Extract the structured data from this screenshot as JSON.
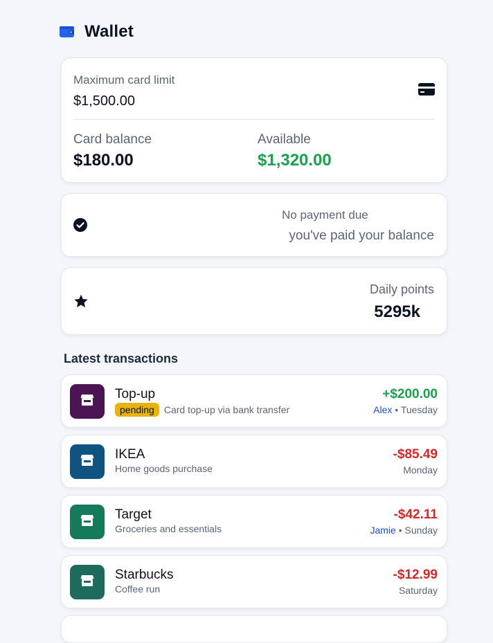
{
  "header": {
    "title": "Wallet",
    "icon": "wallet-icon",
    "accent": "#2563eb"
  },
  "limit_card": {
    "limit_label": "Maximum card limit",
    "limit_value": "$1,500.00",
    "balance_label": "Card balance",
    "balance_value": "$180.00",
    "available_label": "Available",
    "available_value": "$1,320.00",
    "icon": "credit-card-icon"
  },
  "payment_card": {
    "title": "No payment due",
    "subtitle": "you've paid your balance",
    "icon": "check-circle-icon"
  },
  "points_card": {
    "label": "Daily points",
    "value": "5295k",
    "icon": "star-icon"
  },
  "transactions": {
    "title": "Latest transactions",
    "items": [
      {
        "name": "Top-up",
        "badge": "pending",
        "description": "Card top-up via bank transfer",
        "amount": "+$200.00",
        "person": "Alex",
        "separator": " • ",
        "day": "Tuesday",
        "color": "#4a1552",
        "direction": "in",
        "icon": "store-icon"
      },
      {
        "name": "IKEA",
        "badge": "",
        "description": "Home goods purchase",
        "amount": "-$85.49",
        "person": "",
        "separator": "",
        "day": "Monday",
        "color": "#0f5480",
        "direction": "out",
        "icon": "store-icon"
      },
      {
        "name": "Target",
        "badge": "",
        "description": "Groceries and essentials",
        "amount": "-$42.11",
        "person": "Jamie",
        "separator": " • ",
        "day": "Sunday",
        "color": "#157a5c",
        "direction": "out",
        "icon": "store-icon"
      },
      {
        "name": "Starbucks",
        "badge": "",
        "description": "Coffee run",
        "amount": "-$12.99",
        "person": "",
        "separator": "",
        "day": "Saturday",
        "color": "#1e6b5c",
        "direction": "out",
        "icon": "store-icon"
      }
    ]
  }
}
